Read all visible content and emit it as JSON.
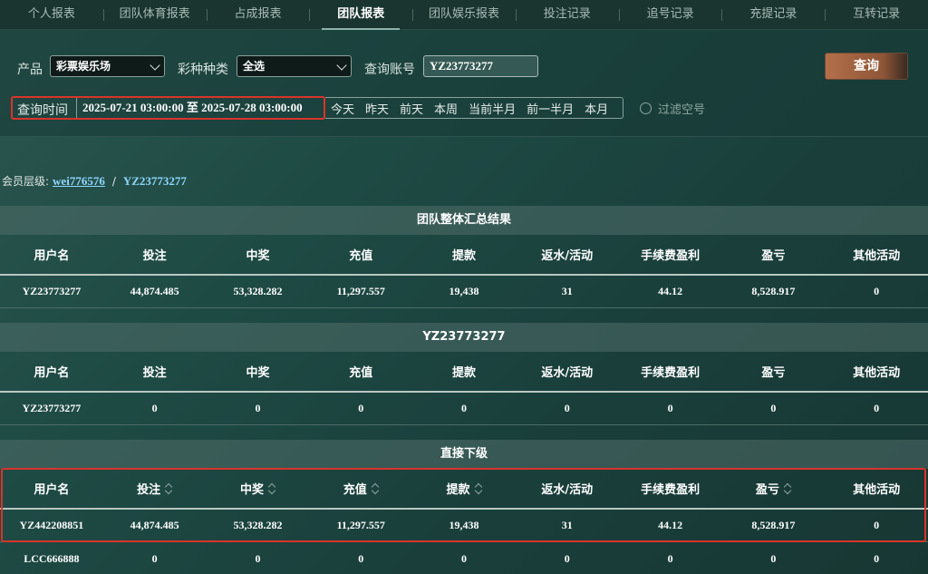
{
  "nav": {
    "tabs": [
      "个人报表",
      "团队体育报表",
      "占成报表",
      "团队报表",
      "团队娱乐报表",
      "投注记录",
      "追号记录",
      "充提记录",
      "互转记录"
    ],
    "active": "团队报表"
  },
  "filters": {
    "product_label": "产品",
    "product_value": "彩票娱乐场",
    "lottery_type_label": "彩种种类",
    "lottery_type_value": "全选",
    "account_label": "查询账号",
    "account_value": "YZ23773277",
    "query_button": "查询",
    "time_label": "查询时间",
    "time_value": "2025-07-21 03:00:00 至 2025-07-28 03:00:00",
    "quick_ranges": [
      "今天",
      "昨天",
      "前天",
      "本周",
      "当前半月",
      "前一半月",
      "本月"
    ],
    "filter_empty_label": "过滤空号"
  },
  "breadcrumb": {
    "label": "会员层级:",
    "parent": "wei776576",
    "separator": "/",
    "current": "YZ23773277"
  },
  "columns": [
    "用户名",
    "投注",
    "中奖",
    "充值",
    "提款",
    "返水/活动",
    "手续费盈利",
    "盈亏",
    "其他活动"
  ],
  "summary": {
    "title": "团队整体汇总结果",
    "rows": [
      [
        "YZ23773277",
        "44,874.485",
        "53,328.282",
        "11,297.557",
        "19,438",
        "31",
        "44.12",
        "8,528.917",
        "0"
      ]
    ]
  },
  "self": {
    "title": "YZ23773277",
    "rows": [
      [
        "YZ23773277",
        "0",
        "0",
        "0",
        "0",
        "0",
        "0",
        "0",
        "0"
      ]
    ]
  },
  "direct": {
    "title": "直接下级",
    "rows": [
      [
        "YZ442208851",
        "44,874.485",
        "53,328.282",
        "11,297.557",
        "19,438",
        "31",
        "44.12",
        "8,528.917",
        "0"
      ],
      [
        "LCC666888",
        "0",
        "0",
        "0",
        "0",
        "0",
        "0",
        "0",
        "0"
      ]
    ]
  }
}
